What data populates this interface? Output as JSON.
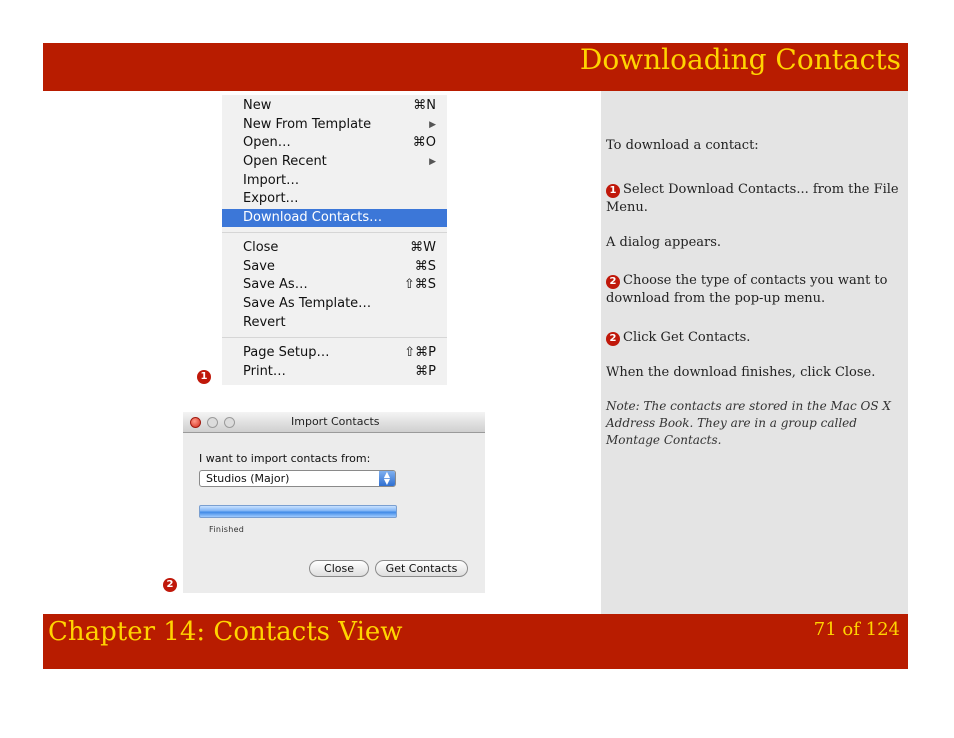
{
  "header": {
    "title": "Downloading Contacts"
  },
  "menu": {
    "items": [
      {
        "label": "New",
        "shortcut": "⌘N"
      },
      {
        "label": "New From Template",
        "shortcut": "▶"
      },
      {
        "label": "Open…",
        "shortcut": "⌘O"
      },
      {
        "label": "Open Recent",
        "shortcut": "▶"
      },
      {
        "label": "Import…",
        "shortcut": ""
      },
      {
        "label": "Export…",
        "shortcut": ""
      },
      {
        "label": "Download Contacts…",
        "shortcut": ""
      },
      {
        "label": "Close",
        "shortcut": "⌘W"
      },
      {
        "label": "Save",
        "shortcut": "⌘S"
      },
      {
        "label": "Save As…",
        "shortcut": "⇧⌘S"
      },
      {
        "label": "Save As Template…",
        "shortcut": ""
      },
      {
        "label": "Revert",
        "shortcut": ""
      },
      {
        "label": "Page Setup…",
        "shortcut": "⇧⌘P"
      },
      {
        "label": "Print…",
        "shortcut": "⌘P"
      }
    ],
    "selected": "Download Contacts…",
    "highlight_color": "#3c77d8"
  },
  "dialog": {
    "title": "Import Contacts",
    "prompt": "I want to import contacts from:",
    "source_value": "Studios (Major)",
    "progress_fraction": 1.0,
    "status": "Finished",
    "close_label": "Close",
    "get_label": "Get Contacts"
  },
  "callouts": {
    "one": "1",
    "two": "2"
  },
  "sidebar": {
    "intro": "To download a contact:",
    "step1_num": "1",
    "step1": "Select Download Contacts... from the File Menu.",
    "dialog_appears": "A dialog appears.",
    "step2_num": "2",
    "step2": "Choose the type of contacts you want to download from the pop-up menu.",
    "step3_num": "2",
    "step3": "Click Get Contacts.",
    "finish": "When the download finishes, click Close.",
    "note": "Note: The contacts are stored in the Mac OS X Address Book. They are in a group called Montage Contacts."
  },
  "footer": {
    "chapter": "Chapter 14: Contacts View",
    "page": "71 of 124"
  },
  "colors": {
    "bar": "#b81c00",
    "bar_text": "#ffd400",
    "sidebar_bg": "#e4e4e4",
    "callout": "#c0180a"
  }
}
